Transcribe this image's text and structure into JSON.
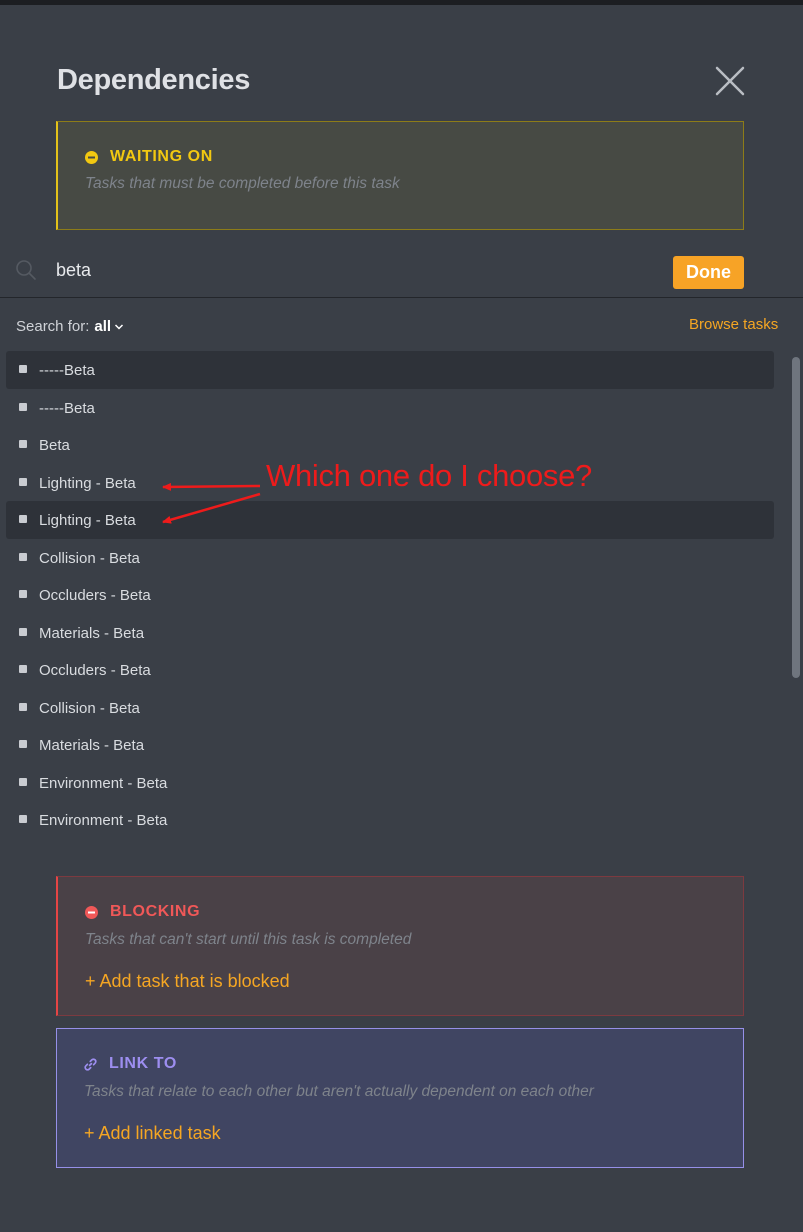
{
  "dialog": {
    "title": "Dependencies"
  },
  "waiting_on": {
    "label": "WAITING ON",
    "description": "Tasks that must be completed before this task",
    "accent": "#f2c811"
  },
  "search": {
    "value": "beta",
    "done_label": "Done"
  },
  "filter": {
    "prefix": "Search for:",
    "value": "all"
  },
  "browse_label": "Browse tasks",
  "results": [
    {
      "label": "-----Beta",
      "highlighted": true
    },
    {
      "label": "-----Beta",
      "highlighted": false
    },
    {
      "label": "Beta",
      "highlighted": false
    },
    {
      "label": "Lighting - Beta",
      "highlighted": false
    },
    {
      "label": "Lighting - Beta",
      "highlighted": true
    },
    {
      "label": "Collision - Beta",
      "highlighted": false
    },
    {
      "label": "Occluders - Beta",
      "highlighted": false
    },
    {
      "label": "Materials - Beta",
      "highlighted": false
    },
    {
      "label": "Occluders - Beta",
      "highlighted": false
    },
    {
      "label": "Collision - Beta",
      "highlighted": false
    },
    {
      "label": "Materials - Beta",
      "highlighted": false
    },
    {
      "label": "Environment - Beta",
      "highlighted": false
    },
    {
      "label": "Environment - Beta",
      "highlighted": false
    }
  ],
  "annotation": {
    "text": "Which one do I choose?",
    "color": "#ee1b1b"
  },
  "blocking": {
    "label": "BLOCKING",
    "description": "Tasks that can't start until this task is completed",
    "add_label": "+ Add task that is blocked",
    "accent": "#f05858"
  },
  "link_to": {
    "label": "LINK TO",
    "description": "Tasks that relate to each other but aren't actually dependent on each other",
    "add_label": "+ Add linked task",
    "accent": "#9d8ef0"
  }
}
